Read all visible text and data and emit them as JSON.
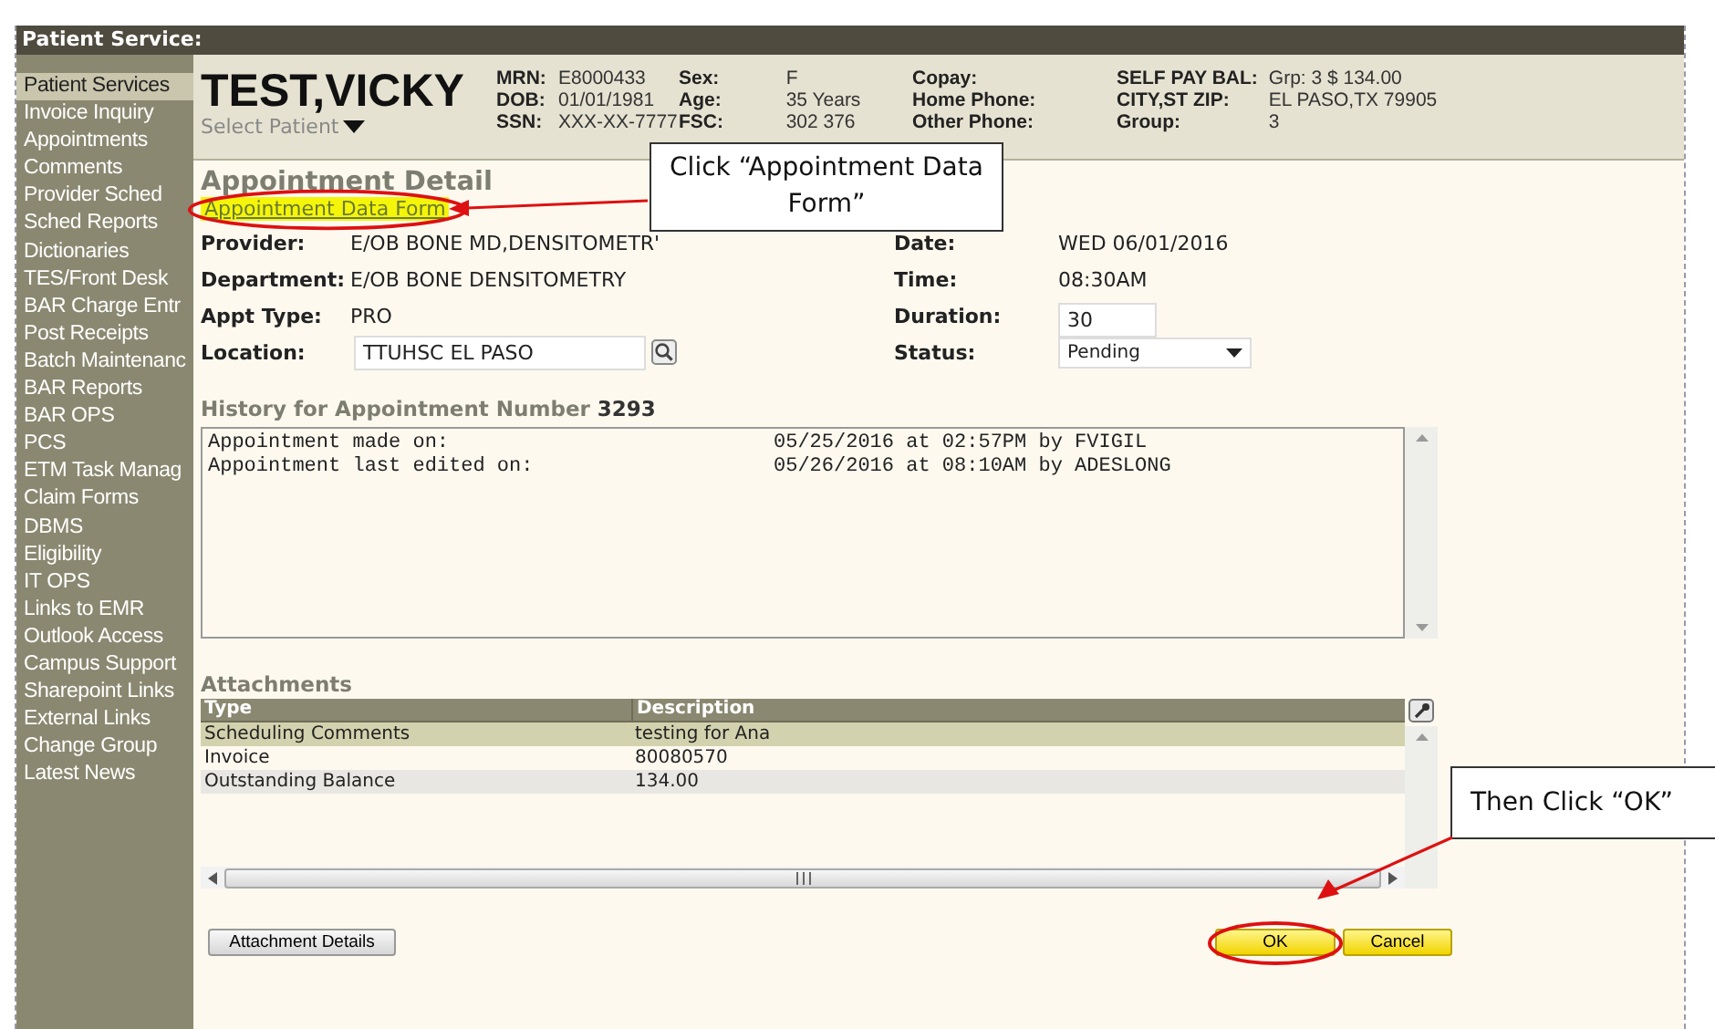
{
  "window": {
    "title": "Patient Service:"
  },
  "sidebar": {
    "items": [
      {
        "label": "Patient Services",
        "selected": true
      },
      {
        "label": "Invoice Inquiry",
        "selected": false
      },
      {
        "label": "Appointments",
        "selected": false
      },
      {
        "label": "Comments",
        "selected": false
      },
      {
        "label": "Provider Sched",
        "selected": false
      },
      {
        "label": "Sched Reports",
        "selected": false
      },
      {
        "label": "Dictionaries",
        "selected": false
      },
      {
        "label": "TES/Front Desk",
        "selected": false
      },
      {
        "label": "BAR Charge Entr",
        "selected": false
      },
      {
        "label": "Post Receipts",
        "selected": false
      },
      {
        "label": "Batch Maintenanc",
        "selected": false
      },
      {
        "label": "BAR Reports",
        "selected": false
      },
      {
        "label": "BAR OPS",
        "selected": false
      },
      {
        "label": "PCS",
        "selected": false
      },
      {
        "label": "ETM Task Manag",
        "selected": false
      },
      {
        "label": "Claim Forms",
        "selected": false
      },
      {
        "label": "DBMS",
        "selected": false
      },
      {
        "label": "Eligibility",
        "selected": false
      },
      {
        "label": "IT OPS",
        "selected": false
      },
      {
        "label": "Links to EMR",
        "selected": false
      },
      {
        "label": "Outlook Access",
        "selected": false
      },
      {
        "label": "Campus Support",
        "selected": false
      },
      {
        "label": "Sharepoint Links",
        "selected": false
      },
      {
        "label": "External Links",
        "selected": false
      },
      {
        "label": "Change Group",
        "selected": false
      },
      {
        "label": "Latest News",
        "selected": false
      }
    ]
  },
  "patient": {
    "name": "TEST,VICKY",
    "select_label": "Select Patient",
    "info_groups": [
      [
        {
          "label": "MRN:",
          "value": "E8000433"
        },
        {
          "label": "DOB:",
          "value": "01/01/1981"
        },
        {
          "label": "SSN:",
          "value": "XXX-XX-7777"
        }
      ],
      [
        {
          "label": "Sex:",
          "value": "F"
        },
        {
          "label": "Age:",
          "value": "35 Years"
        },
        {
          "label": "FSC:",
          "value": "302 376"
        }
      ],
      [
        {
          "label": "Copay:"
        },
        {
          "label": "Home Phone:"
        },
        {
          "label": "Other Phone:"
        }
      ],
      [
        {
          "label": "SELF PAY BAL:",
          "value": "Grp: 3 $ 134.00"
        },
        {
          "label": "CITY,ST ZIP:",
          "value": "EL PASO,TX 79905"
        },
        {
          "label": "Group:",
          "value": "3"
        }
      ]
    ]
  },
  "detail": {
    "title": "Appointment Detail",
    "link": "Appointment Data Form",
    "left_fields": [
      {
        "label": "Provider:",
        "value": "E/OB BONE MD,DENSITOMETR'",
        "kind": "text"
      },
      {
        "label": "Department:",
        "value": "E/OB BONE DENSITOMETRY",
        "kind": "text"
      },
      {
        "label": "Appt Type:",
        "value": "PRO",
        "kind": "text"
      },
      {
        "label": "Location:",
        "value": "TTUHSC EL PASO",
        "kind": "lookup"
      }
    ],
    "right_fields": [
      {
        "label": "Date:",
        "value": "WED  06/01/2016",
        "kind": "text"
      },
      {
        "label": "Time:",
        "value": "08:30AM",
        "kind": "text"
      },
      {
        "label": "Duration:",
        "value": "30",
        "kind": "input"
      },
      {
        "label": "Status:",
        "value": "Pending",
        "kind": "select"
      }
    ]
  },
  "history": {
    "title": "History for Appointment Number",
    "number": "3293",
    "lines": [
      {
        "event": "Appointment made on:",
        "when": "05/25/2016 at 02:57PM by FVIGIL"
      },
      {
        "event": "Appointment last edited on:",
        "when": "05/26/2016 at 08:10AM by ADESLONG"
      }
    ]
  },
  "attachments": {
    "title": "Attachments",
    "columns": [
      "Type",
      "Description"
    ],
    "rows": [
      {
        "type": "Scheduling Comments",
        "description": "testing for Ana",
        "selected": true
      },
      {
        "type": "Invoice",
        "description": "80080570",
        "selected": false
      },
      {
        "type": "Outstanding Balance",
        "description": "134.00",
        "selected": false
      }
    ]
  },
  "buttons": {
    "details": "Attachment Details",
    "ok": "OK",
    "cancel": "Cancel"
  },
  "callouts": {
    "link": "Click “Appointment Data Form”",
    "ok": "Then Click “OK”"
  }
}
